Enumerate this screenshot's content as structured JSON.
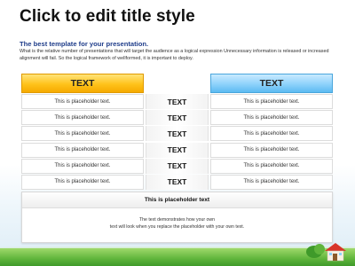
{
  "slide": {
    "title": "Click to edit title style",
    "subtitle": "The best template for your presentation.",
    "body": "What is the relative number of presentations that will target the audience as a logical expression Unnecessary information is released or increased alignment will fail. So the logical framework of wellformed, it is important to deploy."
  },
  "table": {
    "left_header": "TEXT",
    "right_header": "TEXT",
    "left_cells": [
      "This is placeholder text.",
      "This is placeholder text.",
      "This is placeholder text.",
      "This is placeholder text.",
      "This is placeholder text.",
      "This is placeholder text."
    ],
    "middle_cells": [
      "TEXT",
      "TEXT",
      "TEXT",
      "TEXT",
      "TEXT",
      "TEXT"
    ],
    "right_cells": [
      "This is placeholder text.",
      "This is placeholder text.",
      "This is placeholder text.",
      "This is placeholder text.",
      "This is placeholder text.",
      "This is placeholder text."
    ]
  },
  "bottom": {
    "heading": "This is placeholder text",
    "line1": "The text demonstrates how your own",
    "line2": "text will look when you replace the placeholder with your own text."
  },
  "colors": {
    "left_header": "#ffc21a",
    "right_header": "#8ed2fb",
    "subtitle": "#1f3d8a"
  }
}
